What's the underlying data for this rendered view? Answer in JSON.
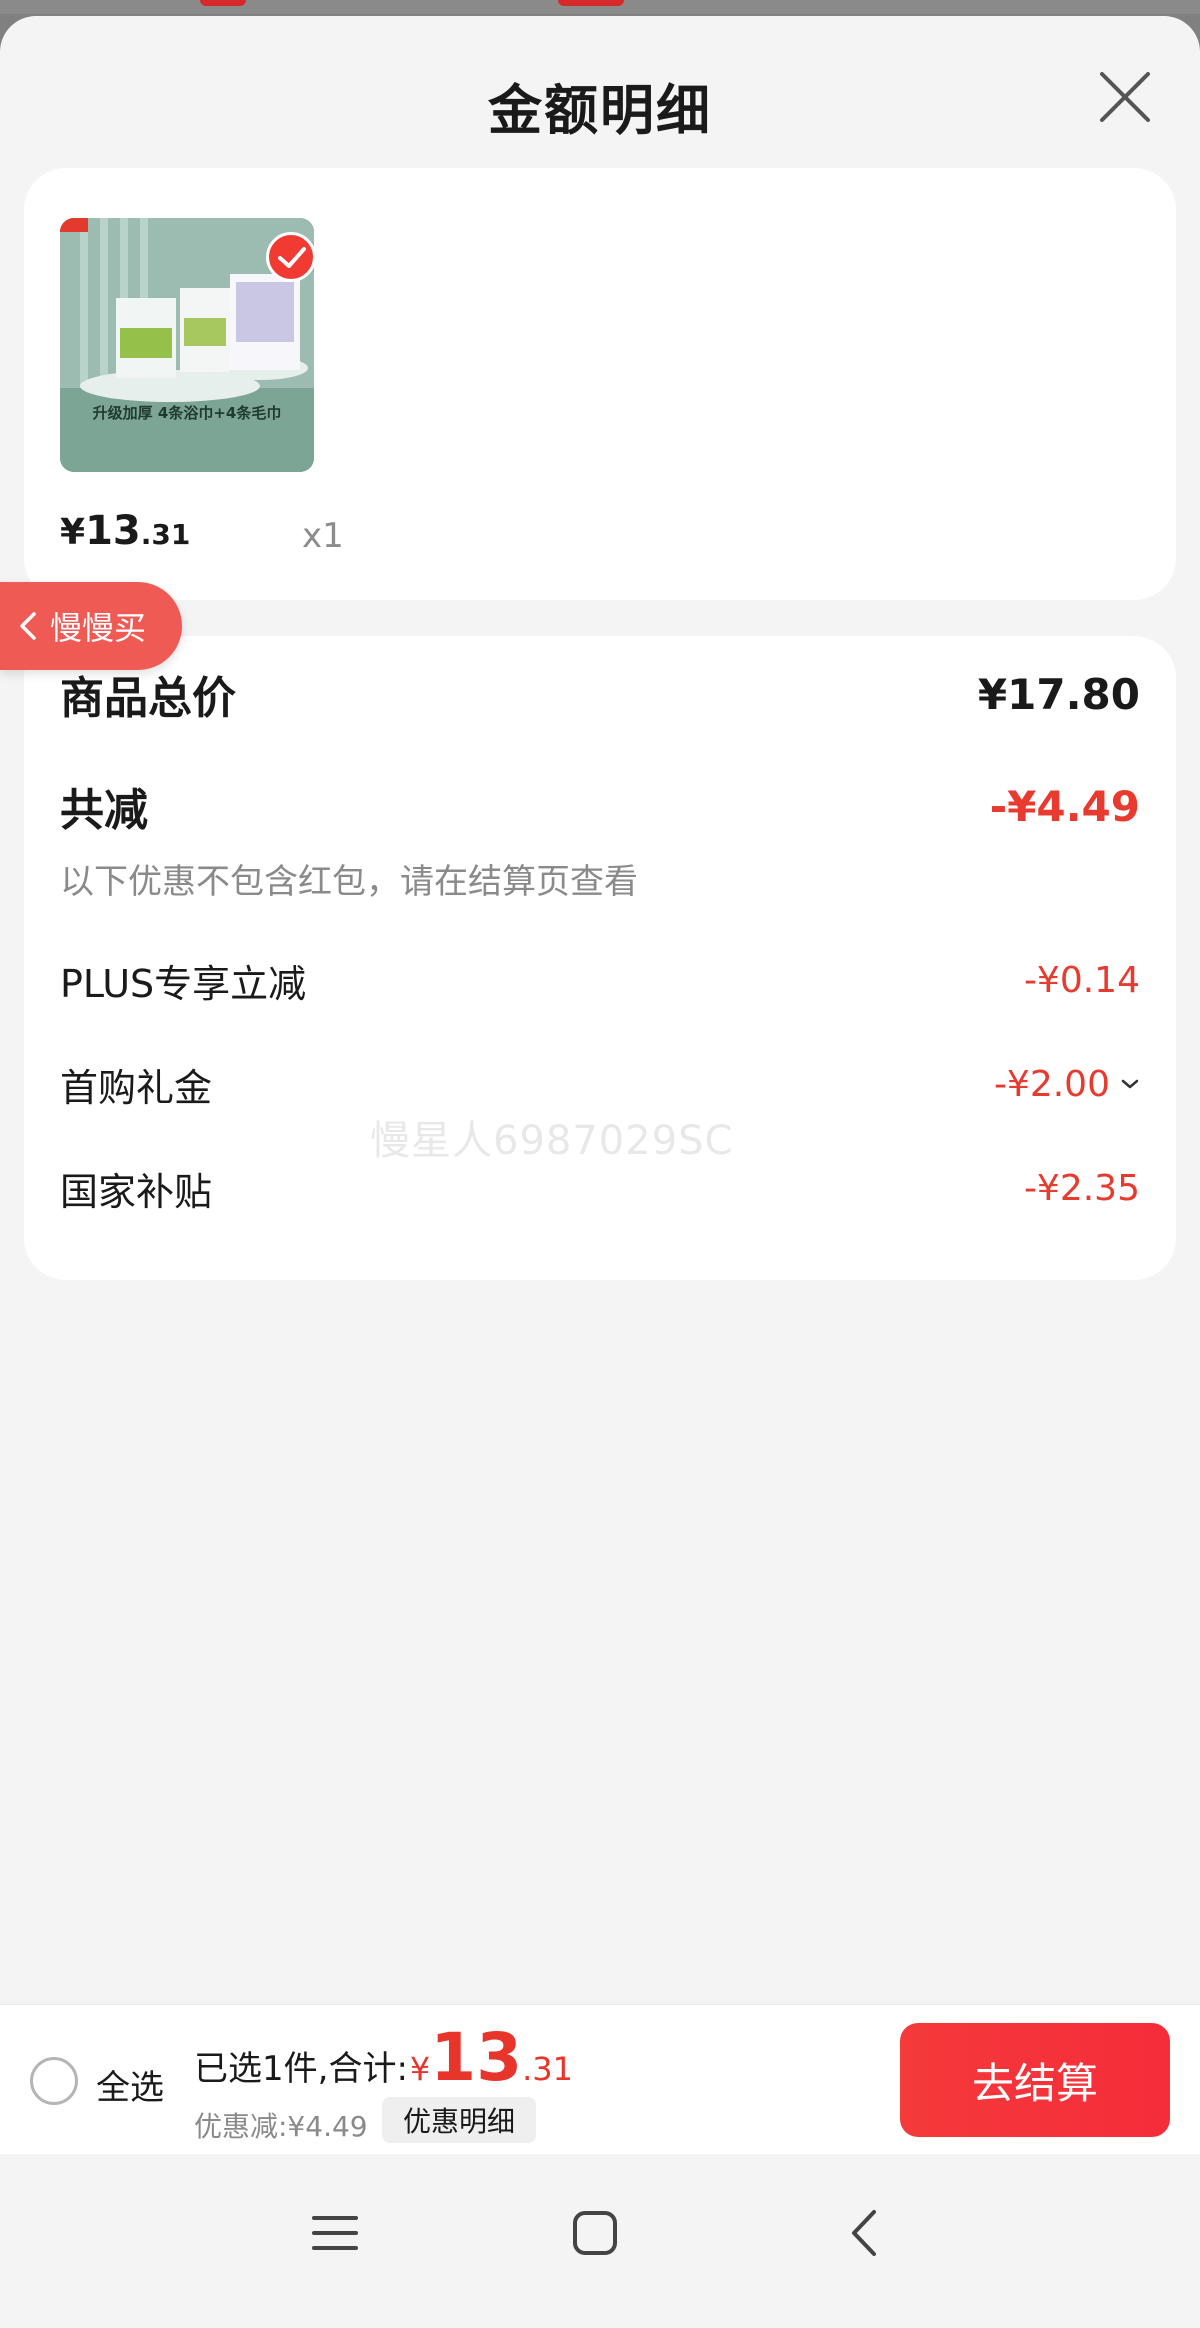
{
  "sheet": {
    "title": "金额明细"
  },
  "product": {
    "image_caption": "升级加厚 4条浴巾+4条毛巾",
    "price_symbol": "¥",
    "price_integer": "13",
    "price_decimal": ".31",
    "quantity": "x1",
    "selected": true
  },
  "slow_buy_tab": {
    "label": "慢慢买"
  },
  "breakdown": {
    "total_label": "商品总价",
    "total_value": "¥17.80",
    "reduce_label": "共减",
    "reduce_value": "-¥4.49",
    "note": "以下优惠不包含红包，请在结算页查看",
    "items": [
      {
        "label": "PLUS专享立减",
        "value": "-¥0.14"
      },
      {
        "label": "首购礼金",
        "value": "-¥2.00"
      },
      {
        "label": "国家补贴",
        "value": "-¥2.35"
      }
    ],
    "watermark": "慢星人6987029SC"
  },
  "bottom_bar": {
    "select_all_label": "全选",
    "summary_label": "已选1件,合计:",
    "total_symbol": "¥",
    "total_integer": "13",
    "total_decimal": ".31",
    "discount_text": "优惠减:¥4.49",
    "detail_button": "优惠明细",
    "checkout_button": "去结算"
  },
  "colors": {
    "accent_red": "#e8352b",
    "tab_red": "#f05a55",
    "sheet_bg": "#f4f4f4",
    "card_bg": "#ffffff"
  },
  "icons": {
    "close": "close-icon",
    "check": "check-icon",
    "chevron_left": "chevron-left-icon",
    "chevron_down": "chevron-down-icon",
    "menu": "menu-icon",
    "home": "home-icon",
    "back": "back-icon"
  }
}
